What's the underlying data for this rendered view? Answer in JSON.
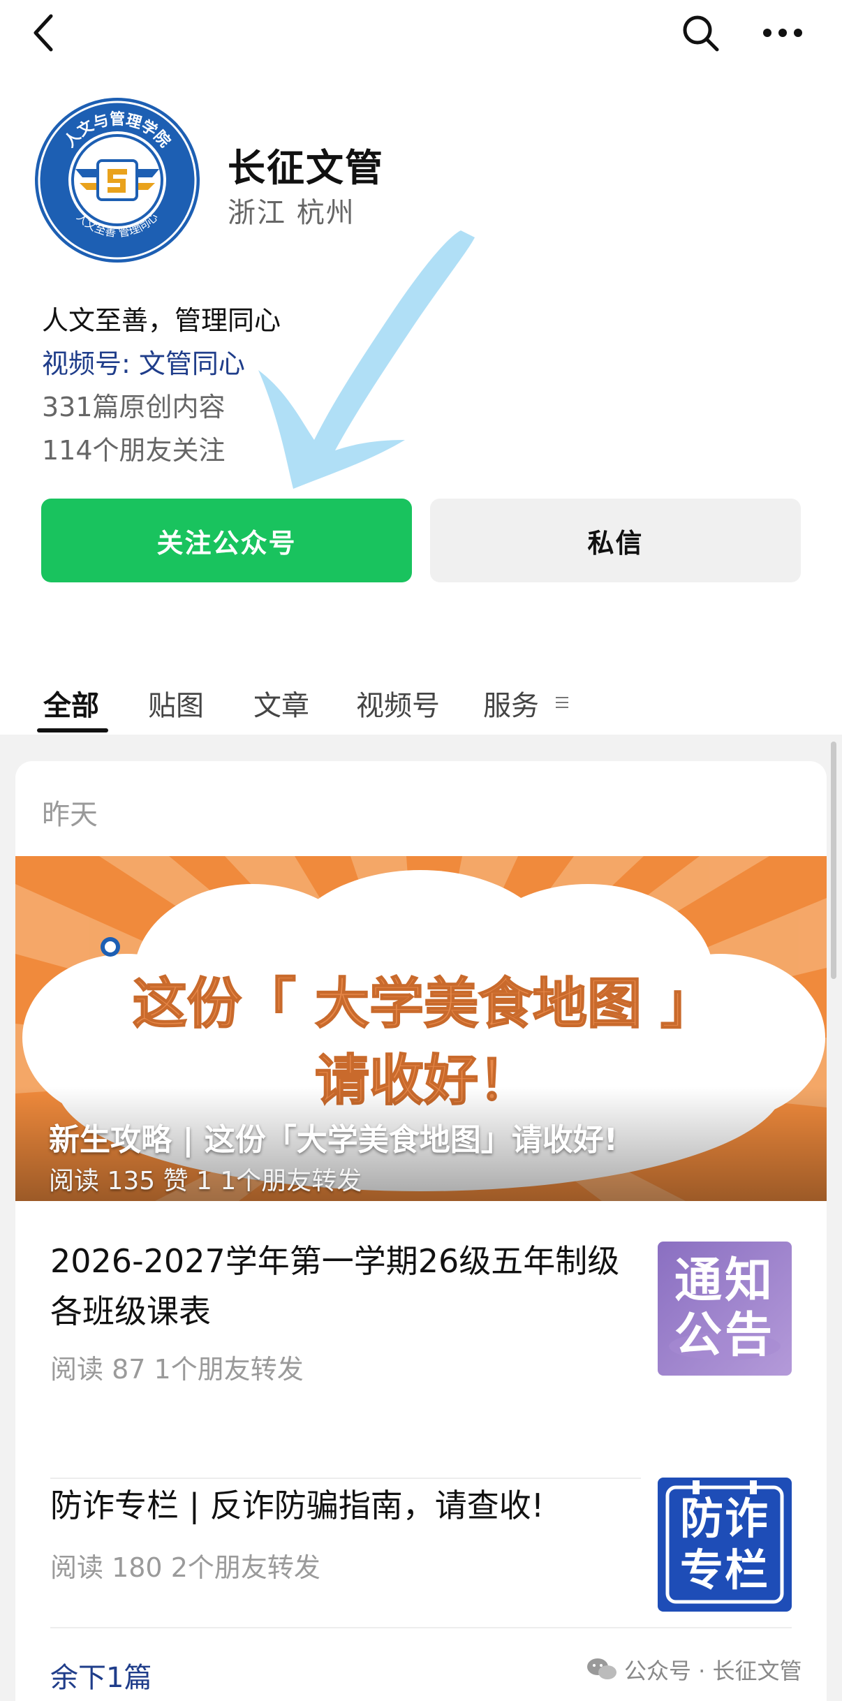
{
  "nav": {
    "back_icon": "chevron-left-icon",
    "search_icon": "search-icon",
    "more_icon": "more-dots-icon"
  },
  "profile": {
    "logo_icon": "college-seal-logo",
    "logo_text": "人文与管理学院",
    "logo_motto": "人文至善 管理同心",
    "name": "长征文管",
    "location": "浙江 杭州",
    "bio": "人文至善，管理同心",
    "channel": "视频号: 文管同心",
    "original_count": "331篇原创内容",
    "friends_following": "114个朋友关注"
  },
  "actions": {
    "follow_label": "关注公众号",
    "message_label": "私信"
  },
  "tabs": [
    {
      "label": "全部",
      "active": true
    },
    {
      "label": "贴图",
      "active": false
    },
    {
      "label": "文章",
      "active": false
    },
    {
      "label": "视频号",
      "active": false
    },
    {
      "label": "服务",
      "active": false
    }
  ],
  "tabs_menu_icon": "list-menu-icon",
  "feed": {
    "date_label": "昨天",
    "banner": {
      "image_line1": "这份「 大学美食地图 」",
      "image_line2": "请收好！",
      "title": "新生攻略 | 这份「大学美食地图」请收好!",
      "meta": "阅读 135   赞 1   1个朋友转发"
    },
    "articles": [
      {
        "title": "2026-2027学年第一学期26级五年制级各班级课表",
        "meta": "阅读 87   1个朋友转发",
        "thumb_text": "通知公告"
      },
      {
        "title": "防诈专栏 | 反诈防骗指南，请查收!",
        "meta": "阅读 180   2个朋友转发",
        "thumb_text": "防诈专栏"
      }
    ],
    "remaining": "余下1篇"
  },
  "watermark": "公众号 · 长征文管",
  "colors": {
    "follow_green": "#19c35e",
    "link_blue": "#1f3d8a",
    "banner_orange": "#f08a3c",
    "annotation_arrow": "#a9dcf5"
  }
}
